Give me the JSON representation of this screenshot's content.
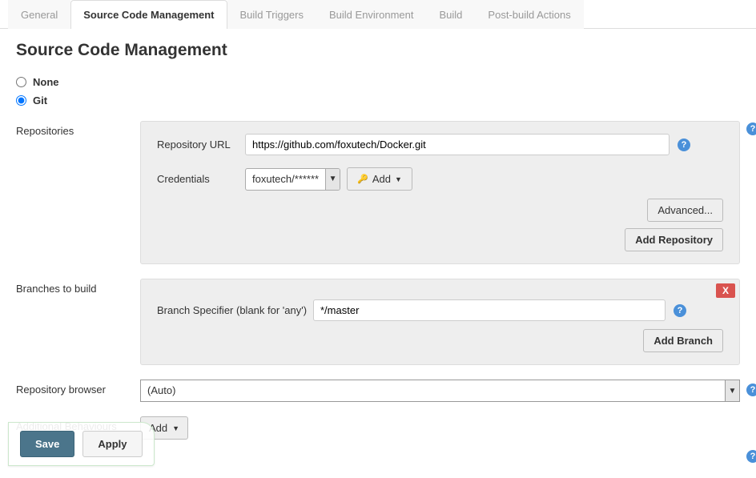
{
  "tabs": [
    "General",
    "Source Code Management",
    "Build Triggers",
    "Build Environment",
    "Build",
    "Post-build Actions"
  ],
  "activeTab": "Source Code Management",
  "page": {
    "title": "Source Code Management"
  },
  "scm": {
    "options": {
      "none": "None",
      "git": "Git"
    }
  },
  "repositories": {
    "label": "Repositories",
    "repoUrlLabel": "Repository URL",
    "repoUrlValue": "https://github.com/foxutech/Docker.git",
    "credentialsLabel": "Credentials",
    "credentialsValue": "foxutech/******",
    "addCredLabel": "Add",
    "advancedLabel": "Advanced...",
    "addRepoLabel": "Add Repository"
  },
  "branches": {
    "label": "Branches to build",
    "specifierLabel": "Branch Specifier (blank for 'any')",
    "specifierValue": "*/master",
    "addBranchLabel": "Add Branch",
    "deleteLabel": "X"
  },
  "browser": {
    "label": "Repository browser",
    "value": "(Auto)"
  },
  "behaviours": {
    "label": "Additional Behaviours",
    "addLabel": "Add"
  },
  "actions": {
    "save": "Save",
    "apply": "Apply"
  }
}
